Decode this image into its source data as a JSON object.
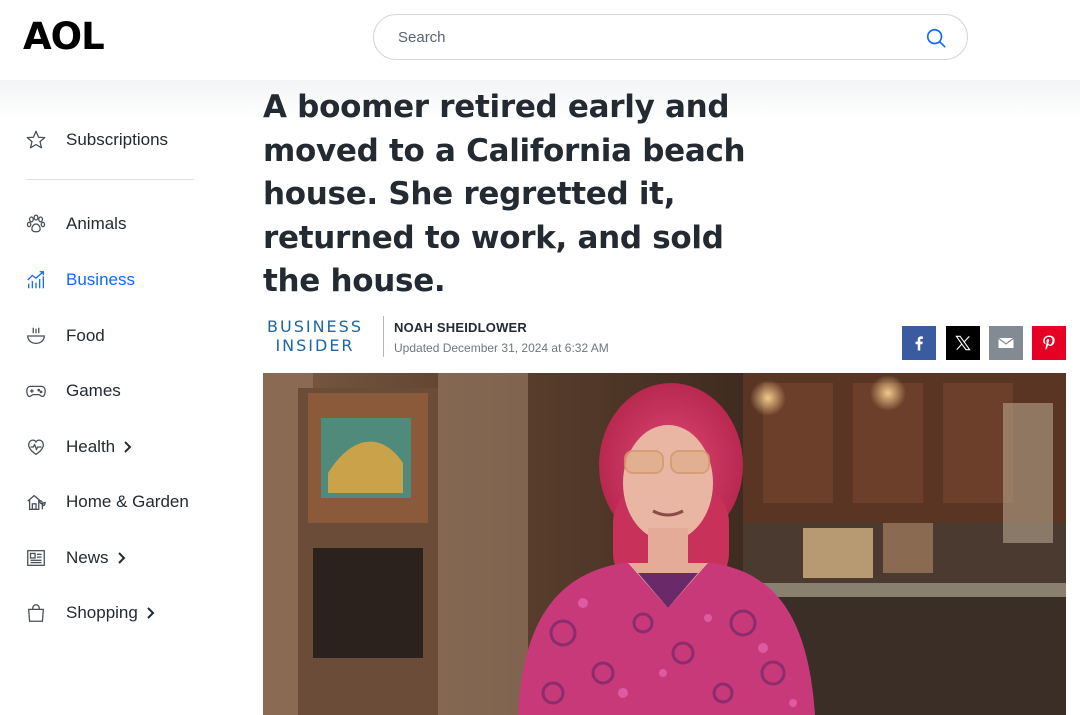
{
  "header": {
    "logo": "AOL",
    "search_placeholder": "Search"
  },
  "sidebar": {
    "items": [
      {
        "label": "Subscriptions",
        "icon": "star-icon"
      },
      {
        "label": "Animals",
        "icon": "paw-icon"
      },
      {
        "label": "Business",
        "icon": "chart-icon",
        "active": true
      },
      {
        "label": "Food",
        "icon": "bowl-icon"
      },
      {
        "label": "Games",
        "icon": "gamepad-icon"
      },
      {
        "label": "Health",
        "icon": "heart-icon",
        "expandable": true
      },
      {
        "label": "Home & Garden",
        "icon": "house-plant-icon"
      },
      {
        "label": "News",
        "icon": "newspaper-icon",
        "expandable": true
      },
      {
        "label": "Shopping",
        "icon": "shopping-bag-icon",
        "expandable": true
      }
    ]
  },
  "article": {
    "headline": "A boomer retired early and moved to a California beach house. She regretted it, returned to work, and sold the house.",
    "source_logo_line1": "BUSINESS",
    "source_logo_line2": "INSIDER",
    "author": "NOAH SHEIDLOWER",
    "updated": "Updated December 31, 2024 at 6:32 AM",
    "share": [
      "facebook",
      "x",
      "email",
      "pinterest"
    ]
  },
  "colors": {
    "accent": "#0f69ff",
    "business_insider": "#1d67a4",
    "facebook": "#3a5b9f",
    "x": "#000000",
    "email": "#828a93",
    "pinterest": "#e60023"
  }
}
